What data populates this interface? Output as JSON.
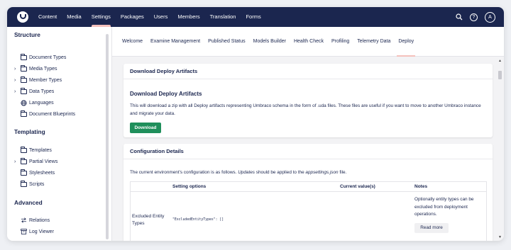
{
  "topnav": {
    "items": [
      "Content",
      "Media",
      "Settings",
      "Packages",
      "Users",
      "Members",
      "Translation",
      "Forms"
    ],
    "active": "Settings",
    "avatar_letter": "A",
    "help_glyph": "?",
    "icons": {
      "logo": "umbraco-logo-icon",
      "search": "search-icon",
      "help": "help-icon"
    }
  },
  "sidebar": {
    "structure_heading": "Structure",
    "structure_items": [
      {
        "label": "Document Types",
        "has_chevron": false,
        "icon": "folder-icon"
      },
      {
        "label": "Media Types",
        "has_chevron": true,
        "icon": "folder-icon"
      },
      {
        "label": "Member Types",
        "has_chevron": true,
        "icon": "folder-icon"
      },
      {
        "label": "Data Types",
        "has_chevron": true,
        "icon": "folder-icon"
      },
      {
        "label": "Languages",
        "has_chevron": false,
        "icon": "globe-icon"
      },
      {
        "label": "Document Blueprints",
        "has_chevron": false,
        "icon": "folder-icon"
      }
    ],
    "templating_heading": "Templating",
    "templating_items": [
      {
        "label": "Templates",
        "has_chevron": false,
        "icon": "folder-icon"
      },
      {
        "label": "Partial Views",
        "has_chevron": true,
        "icon": "folder-icon"
      },
      {
        "label": "Stylesheets",
        "has_chevron": false,
        "icon": "folder-icon"
      },
      {
        "label": "Scripts",
        "has_chevron": false,
        "icon": "folder-icon"
      }
    ],
    "advanced_heading": "Advanced",
    "advanced_items": [
      {
        "label": "Relations",
        "icon": "arrows-icon"
      },
      {
        "label": "Log Viewer",
        "icon": "archive-icon"
      }
    ]
  },
  "tabs": {
    "items": [
      "Welcome",
      "Examine Management",
      "Published Status",
      "Models Builder",
      "Health Check",
      "Profiling",
      "Telemetry Data",
      "Deploy"
    ],
    "active": "Deploy"
  },
  "deploy_card": {
    "title": "Download Deploy Artifacts",
    "heading": "Download Deploy Artifacts",
    "body": "This will download a zip with all Deploy artifacts representing Umbraco schema in the form of .uda files. These files are useful if you want to move to another Umbraco instance and migrate your data.",
    "button_label": "Download",
    "button_color": "#1f8f5b"
  },
  "config_card": {
    "title": "Configuration Details",
    "intro_start": "The current environment's configuration is as follows. ",
    "intro_em1": "Updates",
    "intro_mid": " should be applied to the ",
    "intro_em2": "appsettings.json",
    "intro_end": " file.",
    "table": {
      "headers": {
        "setting": "Setting options",
        "value": "Current value(s)",
        "notes": "Notes"
      },
      "rows": [
        {
          "name": "Excluded Entity Types",
          "value": "\"ExcludedEntityTypes\": []",
          "notes": "Optionally entity types can be excluded from deployment operations.",
          "button_label": "Read more"
        }
      ]
    }
  },
  "colors": {
    "topbar": "#1b264f",
    "accent": "#f5c1bc",
    "text": "#1b264f"
  }
}
